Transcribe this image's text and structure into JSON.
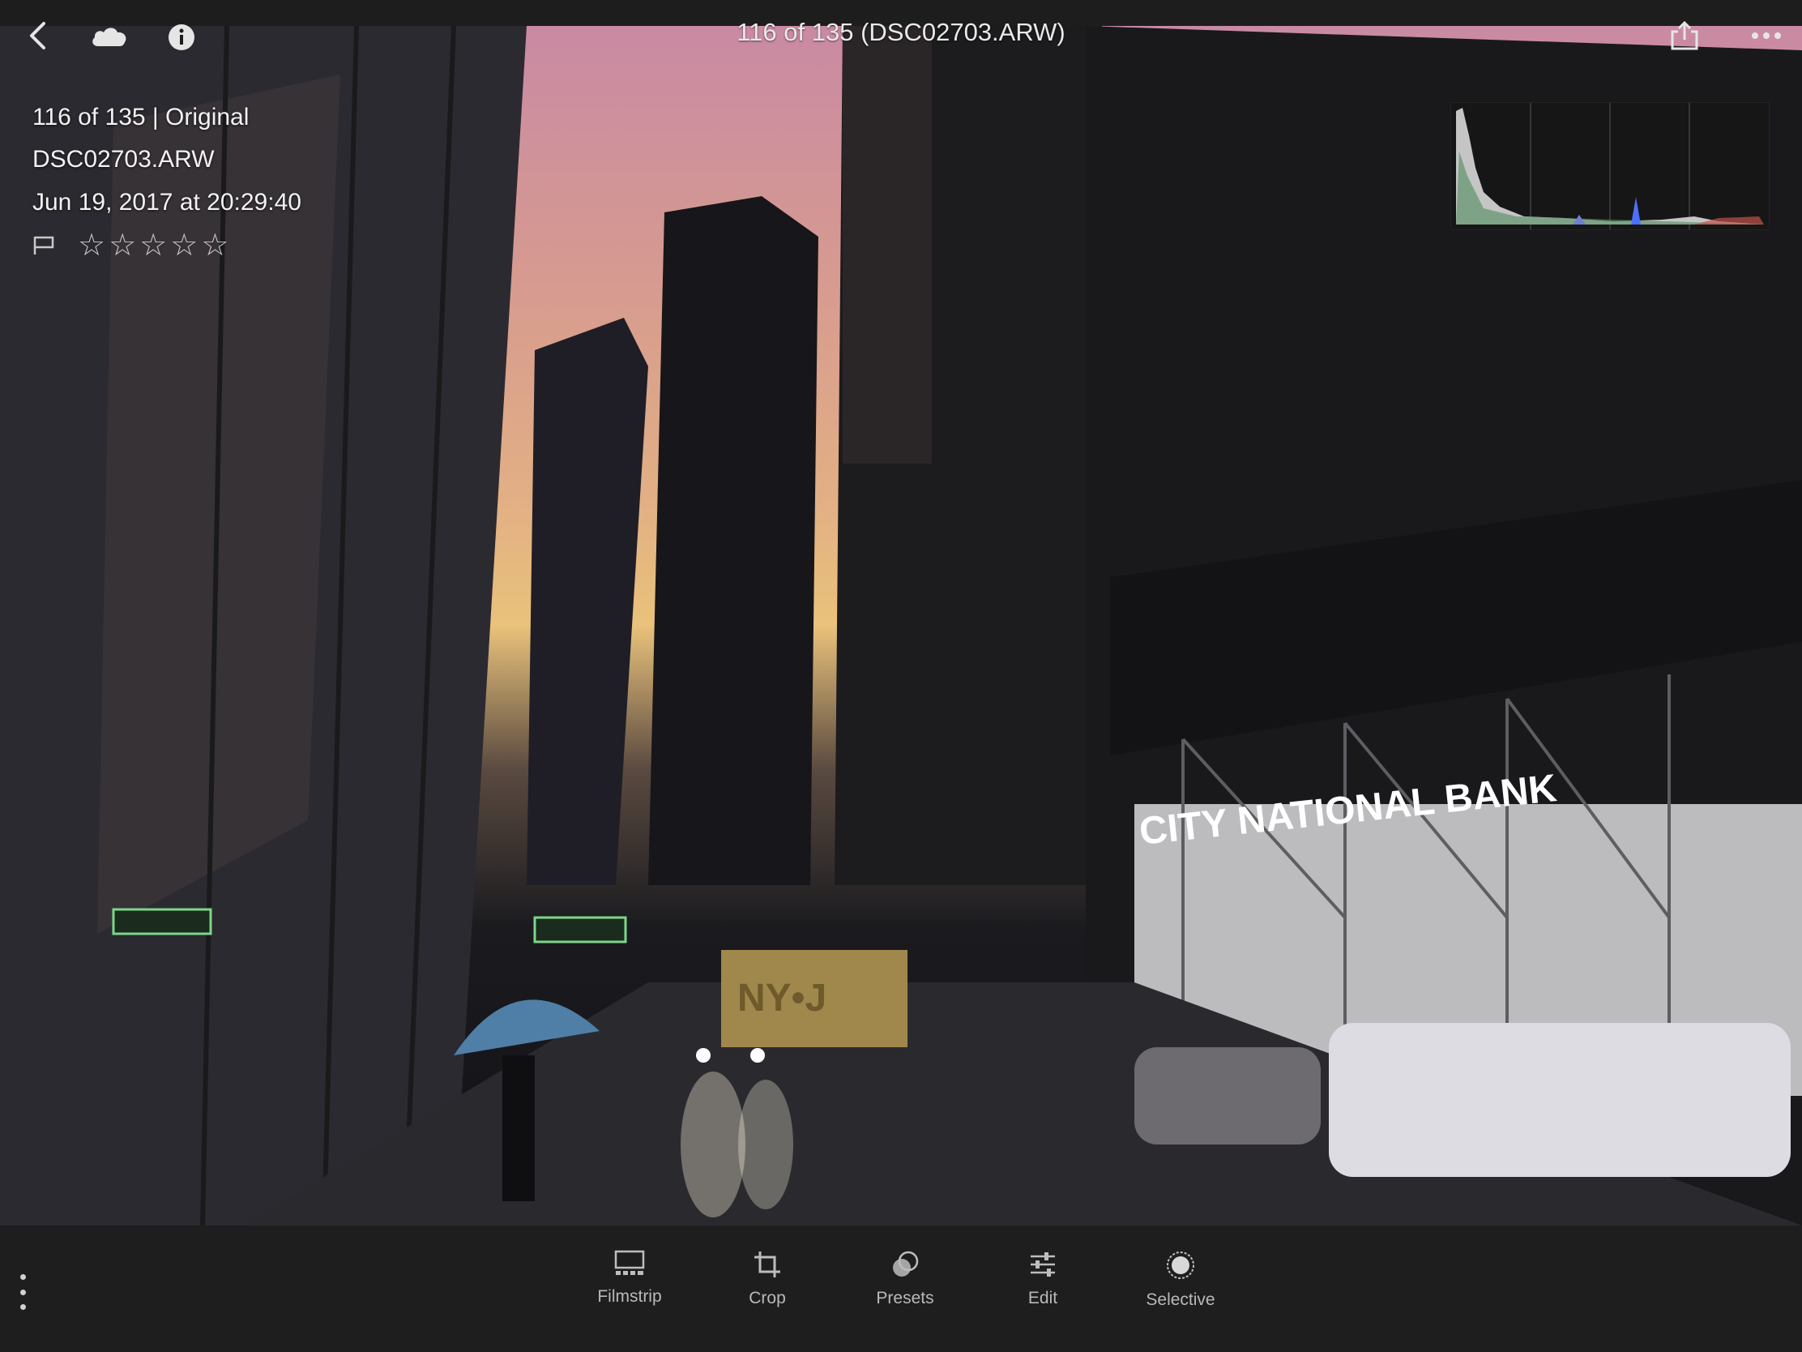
{
  "header": {
    "title": "116 of 135 (DSC02703.ARW)"
  },
  "info": {
    "line1": "116 of 135 | Original",
    "filename": "DSC02703.ARW",
    "datetime": "Jun 19, 2017 at 20:29:40"
  },
  "rating": {
    "stars": 0,
    "max": 5,
    "flagged": false
  },
  "toolbar": {
    "filmstrip": "Filmstrip",
    "crop": "Crop",
    "presets": "Presets",
    "edit": "Edit",
    "selective": "Selective"
  },
  "photo_signs": {
    "bank": "CITY NATIONAL BANK",
    "truck": "NY•J"
  },
  "colors": {
    "ui_bg": "#1e1e1e",
    "label": "#b9b9b9"
  }
}
